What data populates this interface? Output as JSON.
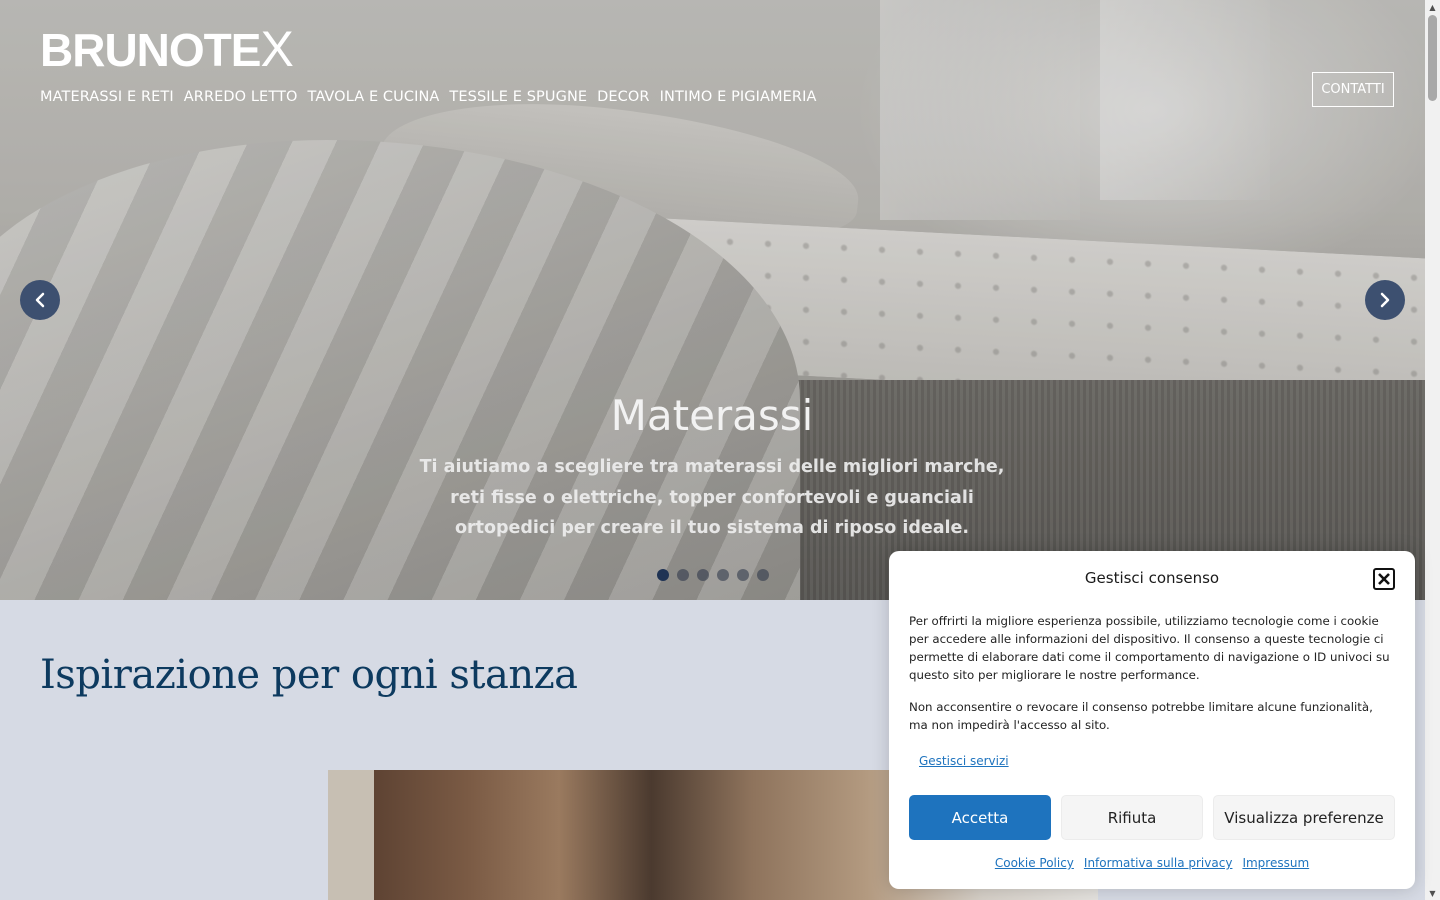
{
  "header": {
    "logo_text": "BRUNOTE",
    "logo_x": "X",
    "nav": [
      "MATERASSI E RETI",
      "ARREDO LETTO",
      "TAVOLA E CUCINA",
      "TESSILE E SPUGNE",
      "DECOR",
      "INTIMO E PIGIAMERIA"
    ],
    "contact_label": "CONTATTI"
  },
  "hero": {
    "title": "Materassi",
    "text": "Ti aiutiamo a scegliere tra materassi delle migliori marche, reti fisse o elettriche, topper confortevoli e guanciali ortopedici per creare il tuo sistema di riposo ideale.",
    "slide_count": 6,
    "active_slide": 1
  },
  "section": {
    "title": "Ispirazione per ogni stanza"
  },
  "cookie": {
    "title": "Gestisci consenso",
    "paragraph1": "Per offrirti la migliore esperienza possibile, utilizziamo tecnologie come i cookie per accedere alle informazioni del dispositivo. Il consenso a queste tecnologie ci permette di elaborare dati come il comportamento di navigazione o ID univoci su questo sito per migliorare le nostre performance.",
    "paragraph2": "Non acconsentire o revocare il consenso potrebbe limitare alcune funzionalità, ma non impedirà l'accesso al sito.",
    "manage_services": "Gestisci servizi",
    "accept": "Accetta",
    "reject": "Rifiuta",
    "preferences": "Visualizza preferenze",
    "links": [
      "Cookie Policy",
      "Informativa sulla privacy",
      "Impressum"
    ]
  },
  "colors": {
    "accent": "#1e73be",
    "heading": "#0d3a5f",
    "section_bg": "#d6dae4",
    "arrow_bg": "#3d5070"
  },
  "icons": {
    "prev": "chevron-left-icon",
    "next": "chevron-right-icon",
    "close": "close-icon"
  }
}
